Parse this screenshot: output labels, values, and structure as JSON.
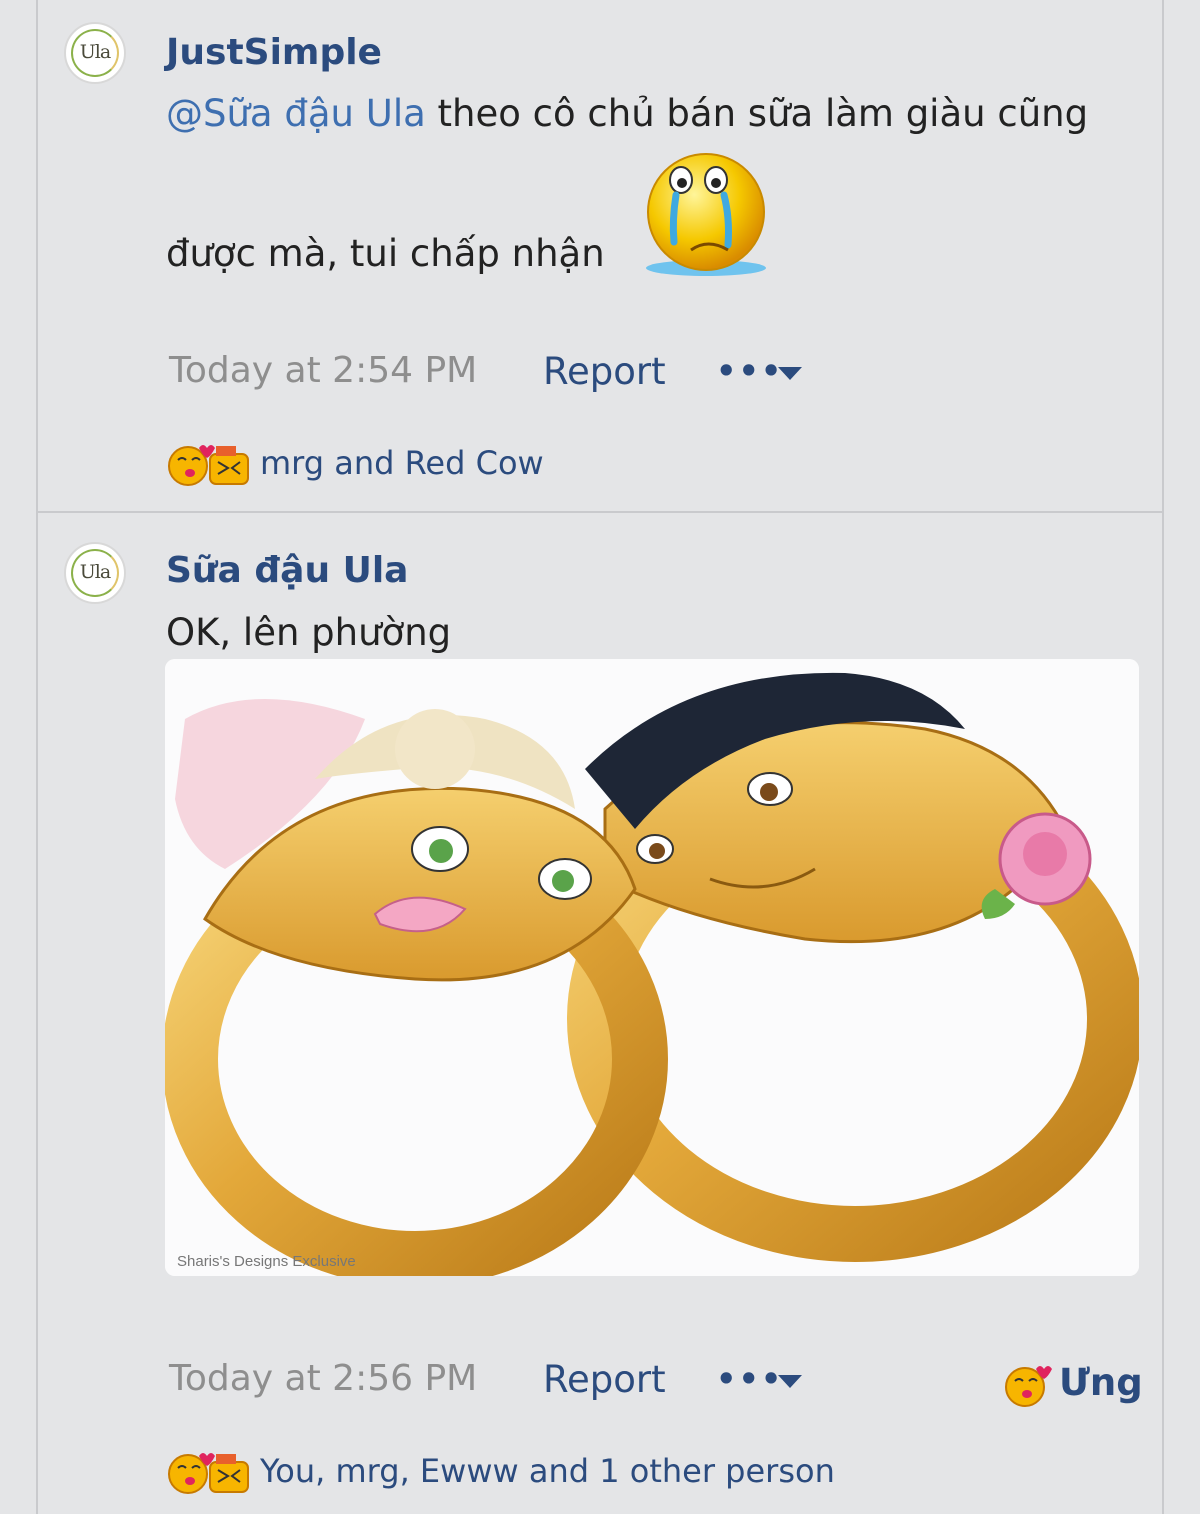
{
  "posts": [
    {
      "avatar_text": "Ula",
      "username": "JustSimple",
      "mention": "@Sữa đậu Ula",
      "text_line1": " theo cô chủ bán sữa làm giàu cũng",
      "text_line2": "được mà, tui chấp nhận",
      "inline_emoji": "crying-smiley-icon",
      "timestamp": "Today at 2:54 PM",
      "report_label": "Report",
      "more_label": "•••",
      "reaction_names": "mrg and Red Cow"
    },
    {
      "avatar_text": "Ula",
      "username": "Sữa đậu Ula",
      "text": "OK, lên phường",
      "image_watermark": "Sharis's Designs Exclusive",
      "timestamp": "Today at 2:56 PM",
      "report_label": "Report",
      "more_label": "•••",
      "like_label": "Ưng",
      "reaction_names": "You, mrg, Ewww and 1 other person"
    }
  ],
  "colors": {
    "background": "#e4e5e7",
    "username": "#2b4b7e",
    "mention": "#3e6fb0",
    "timestamp": "#8e8e8e",
    "text": "#222222"
  }
}
